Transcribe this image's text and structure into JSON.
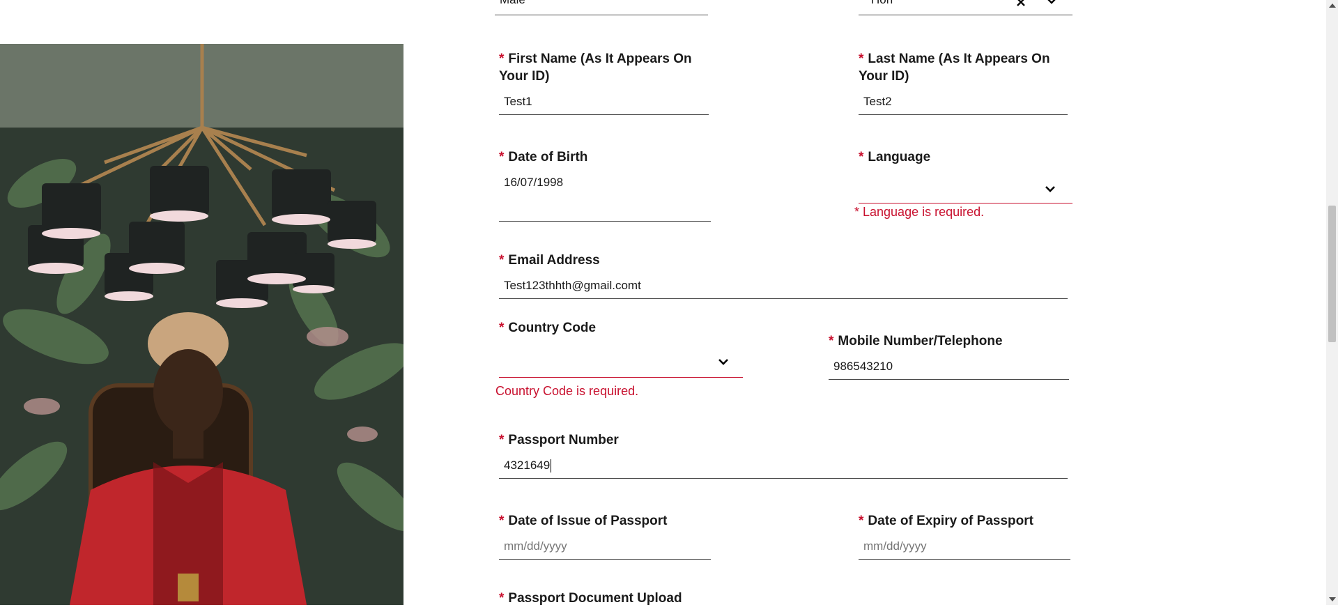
{
  "top_row": {
    "gender_value": "Male",
    "title_value": "Hon"
  },
  "fields": {
    "first_name": {
      "label": "First Name (As It Appears On Your ID)",
      "value": "Test1"
    },
    "last_name": {
      "label": "Last Name (As It Appears On Your ID)",
      "value": "Test2"
    },
    "dob": {
      "label": "Date of Birth",
      "value": "16/07/1998"
    },
    "language": {
      "label": "Language",
      "value": "",
      "error": "* Language is required."
    },
    "email": {
      "label": "Email Address",
      "value": "Test123thhth@gmail.comt"
    },
    "country_code": {
      "label": "Country Code",
      "value": "",
      "error": "Country Code is required."
    },
    "mobile": {
      "label": "Mobile Number/Telephone",
      "value": "986543210"
    },
    "passport_number": {
      "label": "Passport Number",
      "value": "4321649"
    },
    "issue_date": {
      "label": "Date of Issue of Passport",
      "placeholder": "mm/dd/yyyy"
    },
    "expiry_date": {
      "label": "Date of Expiry of Passport",
      "placeholder": "mm/dd/yyyy"
    },
    "passport_upload": {
      "label": "Passport Document Upload"
    }
  },
  "required_marker": "*",
  "colors": {
    "error": "#c8102e",
    "text": "#1a1a1a",
    "underline": "#4a4a4a"
  }
}
